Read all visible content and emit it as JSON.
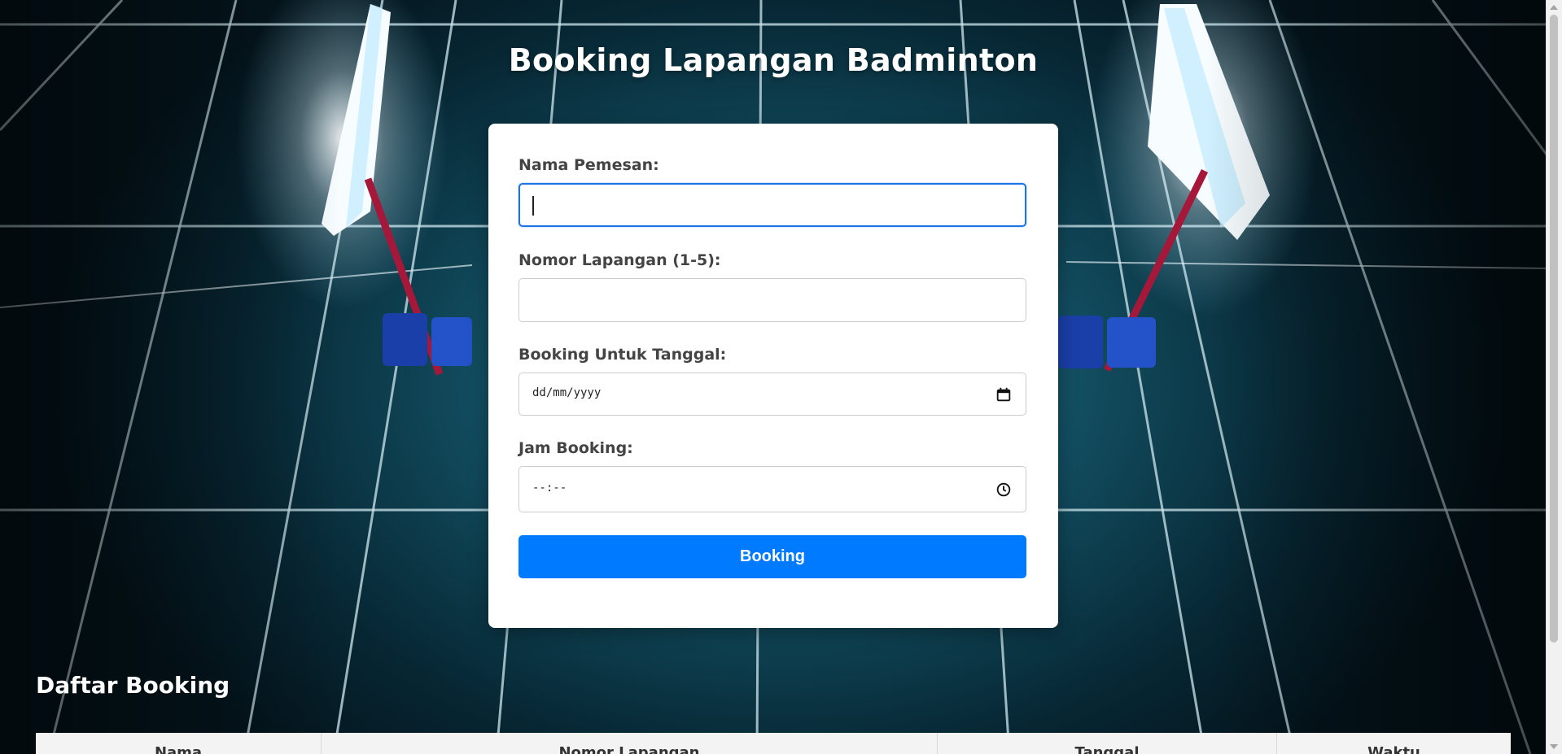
{
  "page": {
    "title": "Booking Lapangan Badminton"
  },
  "form": {
    "name_label": "Nama Pemesan:",
    "name_value": "",
    "court_label": "Nomor Lapangan (1-5):",
    "court_value": "",
    "date_label": "Booking Untuk Tanggal:",
    "date_placeholder": "dd/mm/yyyy",
    "time_label": "Jam Booking:",
    "time_placeholder": "--:--",
    "submit_label": "Booking",
    "accent_color": "#007bff",
    "date_icon": "calendar-icon",
    "time_icon": "clock-icon"
  },
  "list": {
    "title": "Daftar Booking",
    "columns": [
      "Nama",
      "Nomor Lapangan",
      "Tanggal",
      "Waktu"
    ]
  }
}
